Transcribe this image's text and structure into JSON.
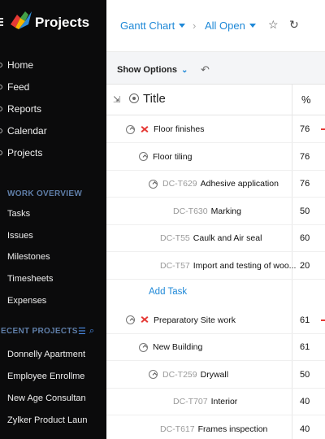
{
  "app": {
    "title": "Projects"
  },
  "nav": [
    {
      "label": "Home",
      "icon": "home-icon"
    },
    {
      "label": "Feed",
      "icon": "feed-icon"
    },
    {
      "label": "Reports",
      "icon": "reports-icon"
    },
    {
      "label": "Calendar",
      "icon": "calendar-icon"
    },
    {
      "label": "Projects",
      "icon": "projects-icon"
    }
  ],
  "work_overview": {
    "label": "WORK OVERVIEW",
    "items": [
      "Tasks",
      "Issues",
      "Milestones",
      "Timesheets",
      "Expenses"
    ]
  },
  "recent_projects": {
    "label": "ECENT PROJECTS",
    "items": [
      "Donnelly Apartment",
      "Employee Enrollme",
      "New Age Consultan",
      "Zylker Product Laun"
    ]
  },
  "toolbar": {
    "view": "Gantt Chart",
    "filter": "All Open",
    "show_options": "Show Options"
  },
  "table": {
    "title_header": "Title",
    "pct_header": "%",
    "add_task": "Add Task",
    "rows": [
      {
        "id": "",
        "title": "Floor finishes",
        "pct": "76",
        "level": 0,
        "milestone": true,
        "toggle": true
      },
      {
        "id": "",
        "title": "Floor tiling",
        "pct": "76",
        "level": 1,
        "milestone": false,
        "toggle": true
      },
      {
        "id": "DC-T629",
        "title": "Adhesive application",
        "pct": "76",
        "level": 2,
        "milestone": false,
        "toggle": true
      },
      {
        "id": "DC-T630",
        "title": "Marking",
        "pct": "50",
        "level": 3,
        "milestone": false,
        "toggle": false
      },
      {
        "id": "DC-T55",
        "title": "Caulk and Air seal",
        "pct": "60",
        "level": 2,
        "milestone": false,
        "toggle": false
      },
      {
        "id": "DC-T57",
        "title": "Import and testing of woo...",
        "pct": "20",
        "level": 2,
        "milestone": false,
        "toggle": false
      },
      {
        "id": "",
        "title": "Preparatory Site work",
        "pct": "61",
        "level": 0,
        "milestone": true,
        "toggle": true
      },
      {
        "id": "",
        "title": "New Building",
        "pct": "61",
        "level": 1,
        "milestone": false,
        "toggle": true
      },
      {
        "id": "DC-T259",
        "title": "Drywall",
        "pct": "50",
        "level": 2,
        "milestone": false,
        "toggle": true
      },
      {
        "id": "DC-T707",
        "title": "Interior",
        "pct": "40",
        "level": 3,
        "milestone": false,
        "toggle": false
      },
      {
        "id": "DC-T617",
        "title": "Frames inspection",
        "pct": "40",
        "level": 2,
        "milestone": false,
        "toggle": false
      }
    ]
  },
  "colors": {
    "accent": "#1e88d7",
    "sidebar_bg": "#0b0b0c",
    "milestone": "#e53935"
  }
}
